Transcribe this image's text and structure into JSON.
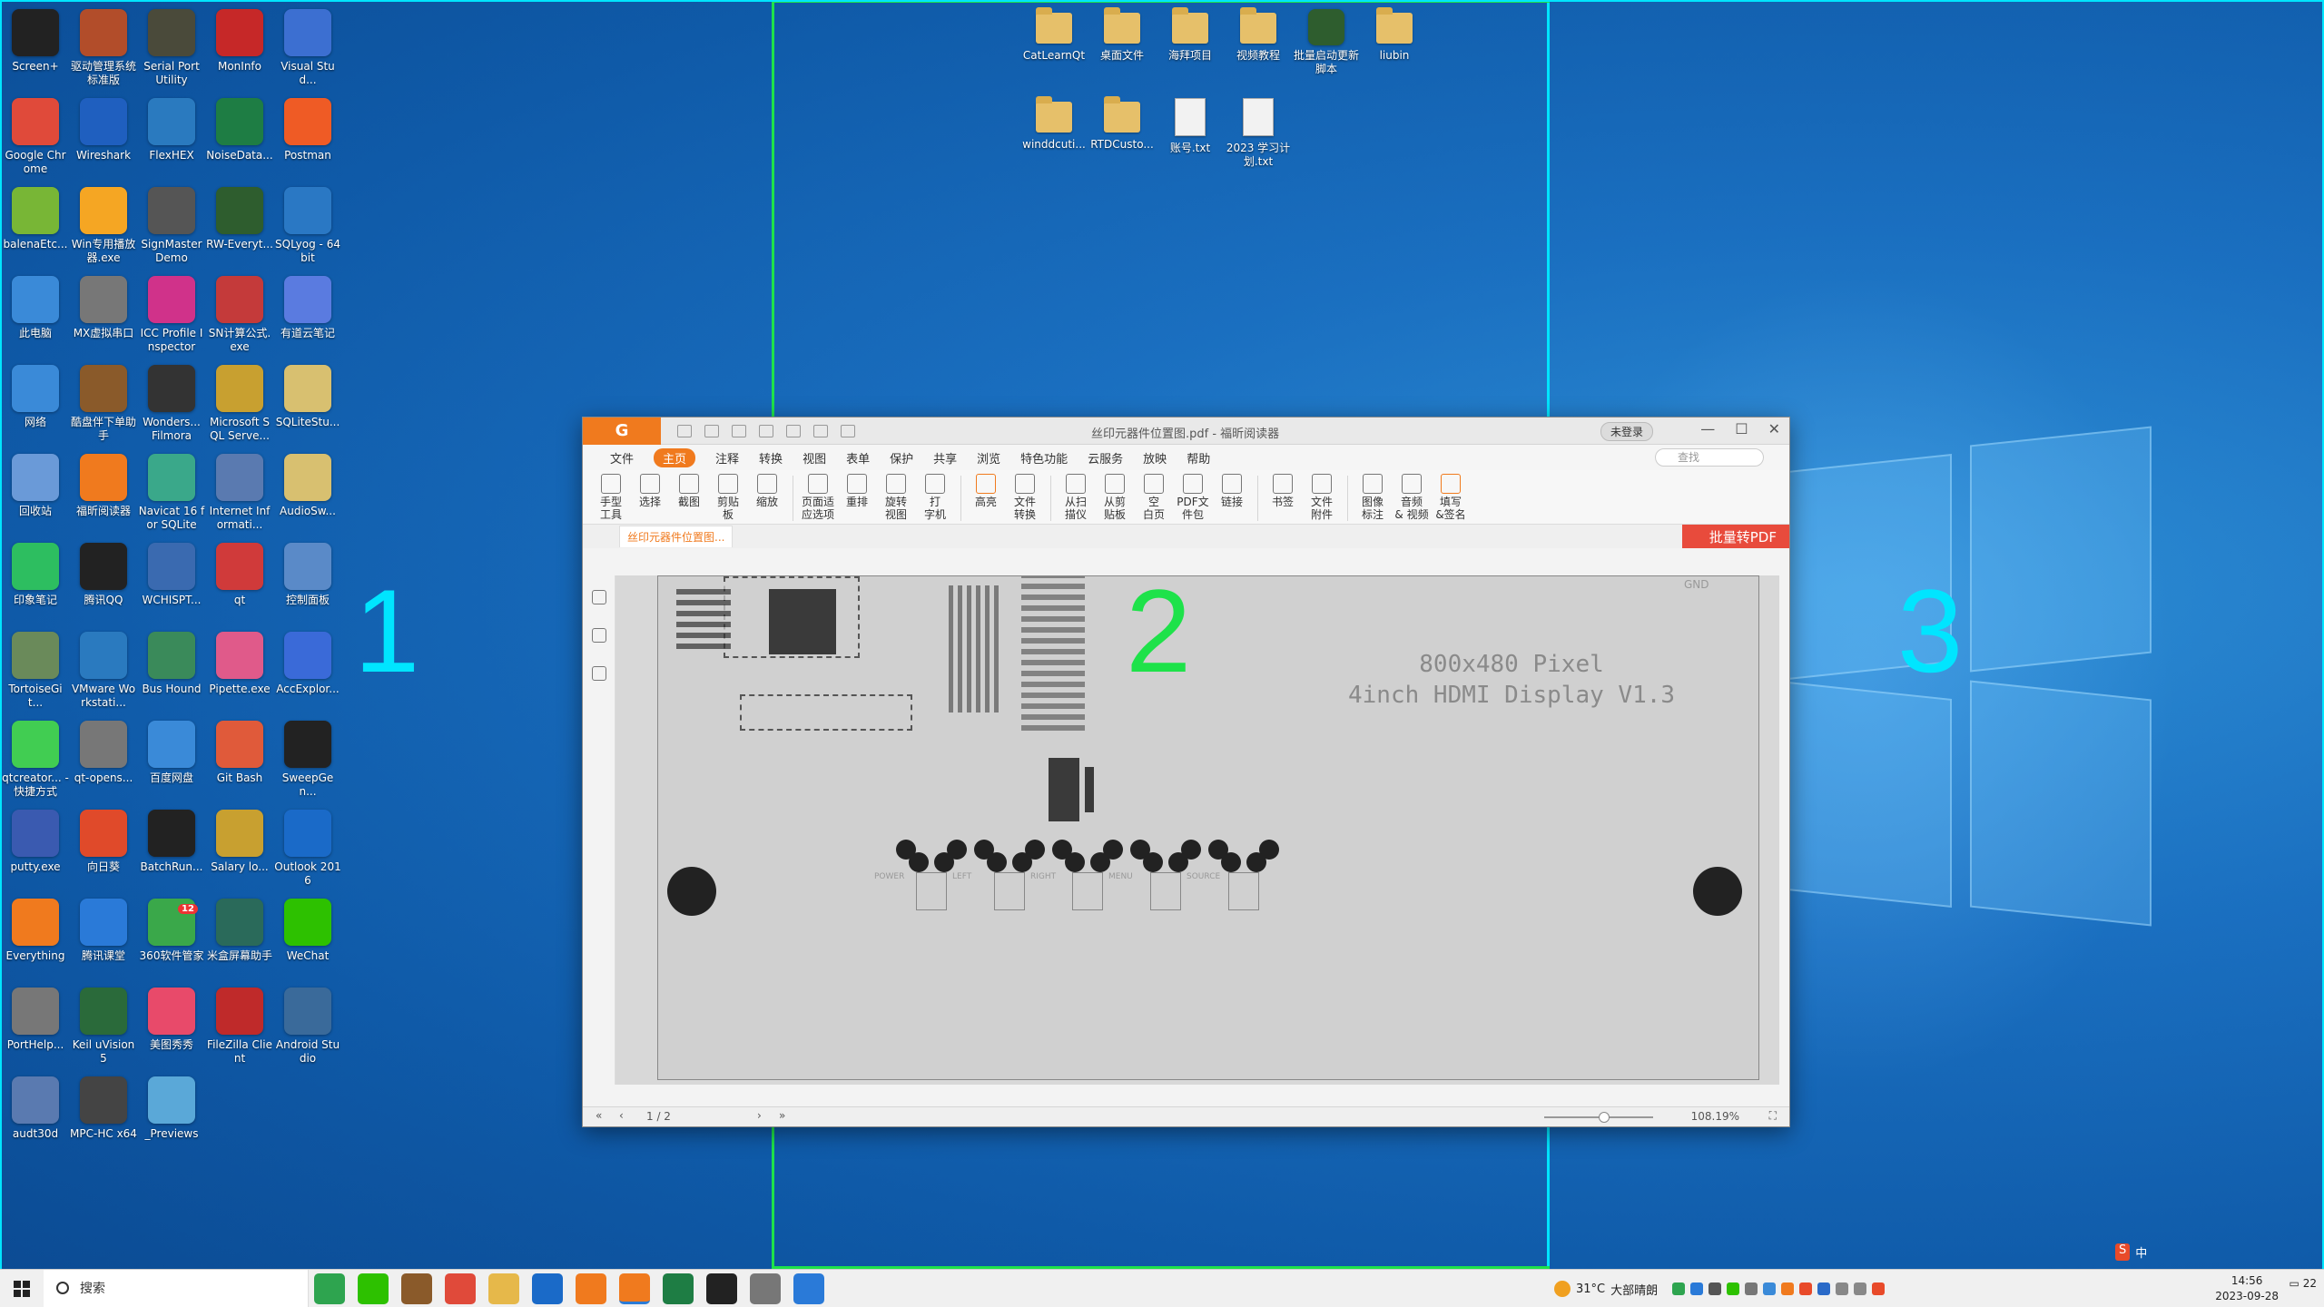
{
  "zones": [
    {
      "label": "1",
      "color": "#00e5ff"
    },
    {
      "label": "2",
      "color": "#1ee24a"
    },
    {
      "label": "3",
      "color": "#00e5ff"
    }
  ],
  "desktop_icons": [
    {
      "label": "Screen+",
      "icon": "screen-icon",
      "color": "#222"
    },
    {
      "label": "驱动管理系统标准版",
      "icon": "home-icon",
      "color": "#b24d2a"
    },
    {
      "label": "Serial Port Utility",
      "icon": "spu-icon",
      "color": "#4a4a3a"
    },
    {
      "label": "MonInfo",
      "icon": "monitor-icon",
      "color": "#c62828"
    },
    {
      "label": "Visual Stud...",
      "icon": "vs-icon",
      "color": "#3c6fd1"
    },
    {
      "label": "Google Chrome",
      "icon": "chrome-icon",
      "color": "#e04a3a"
    },
    {
      "label": "Wireshark",
      "icon": "shark-fin-icon",
      "color": "#1f5fbf"
    },
    {
      "label": "FlexHEX",
      "icon": "globe-icon",
      "color": "#2a7abf"
    },
    {
      "label": "NoiseData...",
      "icon": "excel-icon",
      "color": "#1e7d44"
    },
    {
      "label": "Postman",
      "icon": "postman-icon",
      "color": "#ef5b25"
    },
    {
      "label": "balenaEtc...",
      "icon": "cube-icon",
      "color": "#78b636"
    },
    {
      "label": "Win专用播放器.exe",
      "icon": "play-icon",
      "color": "#f5a623"
    },
    {
      "label": "SignMaster Demo",
      "icon": "pen-icon",
      "color": "#555"
    },
    {
      "label": "RW-Everyt...",
      "icon": "chip-icon",
      "color": "#2e5d2e"
    },
    {
      "label": "SQLyog - 64 bit",
      "icon": "dolphin-icon",
      "color": "#2a78c4"
    },
    {
      "label": "此电脑",
      "icon": "computer-icon",
      "color": "#3a8ad8"
    },
    {
      "label": "MX虚拟串口",
      "icon": "serial-icon",
      "color": "#777"
    },
    {
      "label": "ICC Profile Inspector",
      "icon": "color-icon",
      "color": "#d0328a"
    },
    {
      "label": "SN计算公式.exe",
      "icon": "gauge-icon",
      "color": "#c43a3a"
    },
    {
      "label": "有道云笔记",
      "icon": "note-icon",
      "color": "#5a7be0"
    },
    {
      "label": "网络",
      "icon": "network-icon",
      "color": "#3a8ad8"
    },
    {
      "label": "酷盘伴下单助手",
      "icon": "bear-icon",
      "color": "#8a5a2a"
    },
    {
      "label": "Wonders... Filmora",
      "icon": "filmora-icon",
      "color": "#333"
    },
    {
      "label": "Microsoft SQL Serve...",
      "icon": "sqlserver-icon",
      "color": "#c8a030"
    },
    {
      "label": "SQLiteStu...",
      "icon": "db-icon",
      "color": "#d8c070"
    },
    {
      "label": "回收站",
      "icon": "recycle-bin-icon",
      "color": "#6a9ad8"
    },
    {
      "label": "福昕阅读器",
      "icon": "pdf-reader-icon",
      "color": "#f07a1e"
    },
    {
      "label": "Navicat 16 for SQLite",
      "icon": "navicat-icon",
      "color": "#3aa88a"
    },
    {
      "label": "Internet Informati...",
      "icon": "iis-icon",
      "color": "#5a7ab0"
    },
    {
      "label": "AudioSw...",
      "icon": "audio-icon",
      "color": "#d8c070"
    },
    {
      "label": "印象笔记",
      "icon": "evernote-icon",
      "color": "#2dbe60"
    },
    {
      "label": "腾讯QQ",
      "icon": "qq-icon",
      "color": "#222"
    },
    {
      "label": "WCHISPT...",
      "icon": "satellite-icon",
      "color": "#3a6ab0"
    },
    {
      "label": "qt",
      "icon": "blocked-icon",
      "color": "#d03a3a"
    },
    {
      "label": "控制面板",
      "icon": "control-panel-icon",
      "color": "#5a8ac8"
    },
    {
      "label": "TortoiseGit...",
      "icon": "tortoise-icon",
      "color": "#6a8a5a"
    },
    {
      "label": "VMware Workstati...",
      "icon": "vmware-icon",
      "color": "#2a7abf"
    },
    {
      "label": "Bus Hound",
      "icon": "bushound-icon",
      "color": "#3a8a5a"
    },
    {
      "label": "Pipette.exe",
      "icon": "pipette-icon",
      "color": "#e05a8a"
    },
    {
      "label": "AccExplor...",
      "icon": "tree-icon",
      "color": "#3a6ad8"
    },
    {
      "label": "qtcreator... - 快捷方式",
      "icon": "qtcreator-icon",
      "color": "#41cd52"
    },
    {
      "label": "qt-opens...",
      "icon": "search-folder-icon",
      "color": "#777"
    },
    {
      "label": "百度网盘",
      "icon": "baidu-cloud-icon",
      "color": "#3a8ad8"
    },
    {
      "label": "Git Bash",
      "icon": "git-icon",
      "color": "#e05a3a"
    },
    {
      "label": "SweepGen...",
      "icon": "wave-icon",
      "color": "#222"
    },
    {
      "label": "putty.exe",
      "icon": "putty-icon",
      "color": "#3a5ab0"
    },
    {
      "label": "向日葵",
      "icon": "sunflower-icon",
      "color": "#e04a2a"
    },
    {
      "label": "BatchRun...",
      "icon": "terminal-icon",
      "color": "#222"
    },
    {
      "label": "Salary lo...",
      "icon": "coins-icon",
      "color": "#c8a030"
    },
    {
      "label": "Outlook 2016",
      "icon": "outlook-icon",
      "color": "#1a6ac8"
    },
    {
      "label": "Everything",
      "icon": "magnifier-icon",
      "color": "#f07a1e"
    },
    {
      "label": "腾讯课堂",
      "icon": "classroom-icon",
      "color": "#2a7ad8"
    },
    {
      "label": "360软件管家",
      "icon": "360-icon",
      "color": "#3aa84a",
      "badge": "12"
    },
    {
      "label": "米盒屏幕助手",
      "icon": "screen-share-icon",
      "color": "#2a6a5a"
    },
    {
      "label": "WeChat",
      "icon": "wechat-icon",
      "color": "#2dc100"
    },
    {
      "label": "PortHelp...",
      "icon": "gear-icon",
      "color": "#777"
    },
    {
      "label": "Keil uVision5",
      "icon": "keil-icon",
      "color": "#2a6a3a"
    },
    {
      "label": "美图秀秀",
      "icon": "meitu-icon",
      "color": "#e84a6a"
    },
    {
      "label": "FileZilla Client",
      "icon": "filezilla-icon",
      "color": "#bf2a2a"
    },
    {
      "label": "Android Studio",
      "icon": "android-studio-icon",
      "color": "#3a6a9a"
    },
    {
      "label": "audt30d",
      "icon": "spreadsheet-icon",
      "color": "#5a7ab0"
    },
    {
      "label": "MPC-HC x64",
      "icon": "mpc-icon",
      "color": "#444"
    },
    {
      "label": "_Previews",
      "icon": "folder-icon",
      "color": "#5aa8d8"
    }
  ],
  "top_files": [
    {
      "label": "CatLearnQt",
      "type": "folder"
    },
    {
      "label": "桌面文件",
      "type": "folder-doc"
    },
    {
      "label": "海拜项目",
      "type": "folder-doc"
    },
    {
      "label": "视频教程",
      "type": "folder-doc"
    },
    {
      "label": "批量启动更新脚本",
      "type": "app"
    },
    {
      "label": "liubin",
      "type": "folder-doc"
    },
    {
      "label": "winddcuti...",
      "type": "folder"
    },
    {
      "label": "RTDCusto...",
      "type": "folder-doc"
    },
    {
      "label": "账号.txt",
      "type": "doc"
    },
    {
      "label": "2023 学习计划.txt",
      "type": "doc"
    }
  ],
  "window": {
    "app_logo": "G",
    "title": "丝印元器件位置图.pdf - 福昕阅读器",
    "login": "未登录",
    "menu": [
      "文件",
      "主页",
      "注释",
      "转换",
      "视图",
      "表单",
      "保护",
      "共享",
      "浏览",
      "特色功能",
      "云服务",
      "放映",
      "帮助"
    ],
    "search_placeholder": "查找",
    "ribbon": [
      {
        "label": "手型\n工具",
        "icon": "hand-icon"
      },
      {
        "label": "选择",
        "icon": "select-icon"
      },
      {
        "label": "截图",
        "icon": "screenshot-icon"
      },
      {
        "label": "剪贴\n板",
        "icon": "clipboard-icon"
      },
      {
        "label": "缩放",
        "icon": "zoom-icon"
      },
      {
        "label": "页面适\n应选项",
        "icon": "fit-page-icon"
      },
      {
        "label": "重排",
        "icon": "reflow-icon"
      },
      {
        "label": "旋转\n视图",
        "icon": "rotate-icon"
      },
      {
        "label": "打\n字机",
        "icon": "typewriter-icon"
      },
      {
        "label": "高亮",
        "icon": "highlight-icon"
      },
      {
        "label": "文件\n转换",
        "icon": "convert-icon"
      },
      {
        "label": "从扫\n描仪",
        "icon": "scanner-icon"
      },
      {
        "label": "从剪\n贴板",
        "icon": "paste-icon"
      },
      {
        "label": "空\n白页",
        "icon": "blank-page-icon"
      },
      {
        "label": "PDF文\n件包",
        "icon": "pdf-package-icon"
      },
      {
        "label": "链接",
        "icon": "link-icon"
      },
      {
        "label": "书签",
        "icon": "bookmark-icon"
      },
      {
        "label": "文件\n附件",
        "icon": "attachment-icon"
      },
      {
        "label": "图像\n标注",
        "icon": "image-annot-icon"
      },
      {
        "label": "音频\n& 视频",
        "icon": "media-icon"
      },
      {
        "label": "填写\n&签名",
        "icon": "sign-icon"
      }
    ],
    "doc_tab": "丝印元器件位置图...",
    "batch_button": "批量转PDF",
    "pcb_text": [
      "800x480 Pixel",
      "4inch HDMI Display V1.3"
    ],
    "pcb_labels": {
      "gnd": "GND",
      "buttons": [
        "POWER",
        "LEFT",
        "RIGHT",
        "MENU",
        "SOURCE"
      ]
    },
    "page_indicator": "1 / 2",
    "zoom": "108.19%"
  },
  "taskbar": {
    "search_placeholder": "搜索",
    "apps": [
      {
        "name": "green-app-icon",
        "color": "#2ea44f"
      },
      {
        "name": "wechat-icon",
        "color": "#2dc100"
      },
      {
        "name": "bear-icon",
        "color": "#8a5a2a"
      },
      {
        "name": "chrome-icon",
        "color": "#e04a3a"
      },
      {
        "name": "file-explorer-icon",
        "color": "#e6b84a"
      },
      {
        "name": "outlook-icon",
        "color": "#1a6ac8"
      },
      {
        "name": "everything-icon",
        "color": "#f07a1e"
      },
      {
        "name": "foxit-icon",
        "color": "#f07a1e",
        "active": true
      },
      {
        "name": "excel-icon",
        "color": "#1e7d44"
      },
      {
        "name": "terminal-icon",
        "color": "#222"
      },
      {
        "name": "tool-icon",
        "color": "#777"
      },
      {
        "name": "vscode-icon",
        "color": "#2a7ad8"
      }
    ],
    "weather_temp": "31°C",
    "weather_desc": "大部晴朗",
    "time": "14:56",
    "date": "2023-09-28",
    "notif_count": "22",
    "ime": "中"
  }
}
